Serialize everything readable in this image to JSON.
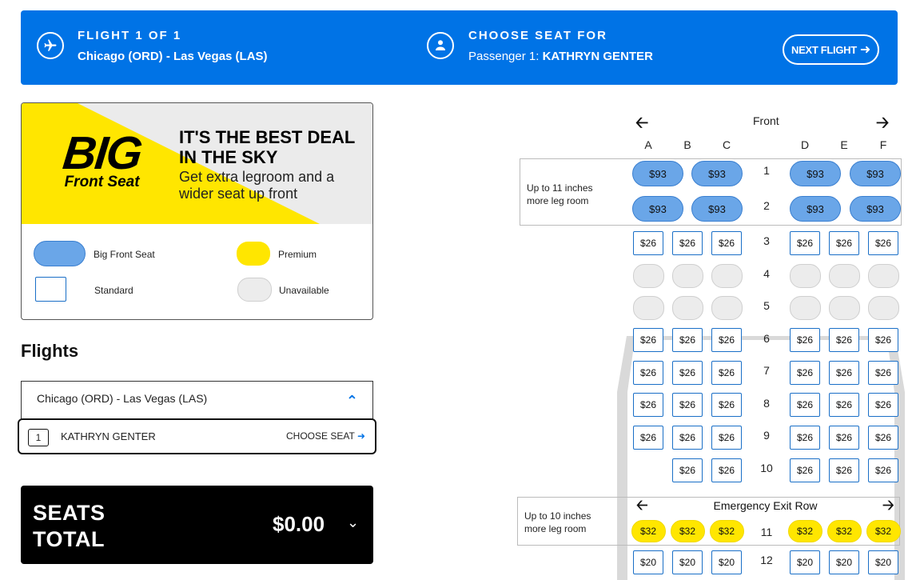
{
  "header": {
    "flight_kicker": "FLIGHT 1 OF 1",
    "flight_route": "Chicago (ORD) - Las Vegas (LAS)",
    "seat_kicker": "CHOOSE SEAT FOR",
    "passenger_prefix": "Passenger 1: ",
    "passenger_name": "KATHRYN GENTER",
    "next_flight_label": "NEXT FLIGHT"
  },
  "promo": {
    "logo_big": "BIG",
    "logo_sub": "Front Seat",
    "headline": "IT'S THE BEST DEAL IN THE SKY",
    "subline": "Get extra legroom and a wider seat up front",
    "legend": {
      "big_front_seat": "Big Front Seat",
      "premium": "Premium",
      "standard": "Standard",
      "unavailable": "Unavailable"
    }
  },
  "flights": {
    "title": "Flights",
    "route": "Chicago (ORD) - Las Vegas (LAS)",
    "passenger_number": "1",
    "passenger_name": "KATHRYN GENTER",
    "choose_seat_label": "CHOOSE SEAT"
  },
  "total": {
    "label_line1": "SEATS",
    "label_line2": "TOTAL",
    "amount": "$0.00"
  },
  "seatmap": {
    "front_label": "Front",
    "columns": [
      "A",
      "B",
      "C",
      "D",
      "E",
      "F"
    ],
    "zone_big_label": "Up to 11 inches more leg room",
    "zone_exit_label": "Up to 10 inches more leg room",
    "exit_row_label": "Emergency Exit Row",
    "rows": [
      {
        "row": "1",
        "type": "big",
        "seats": [
          "$93",
          "$93",
          "$93",
          "$93"
        ]
      },
      {
        "row": "2",
        "type": "big",
        "seats": [
          "$93",
          "$93",
          "$93",
          "$93"
        ]
      },
      {
        "row": "3",
        "type": "std",
        "seats": [
          "$26",
          "$26",
          "$26",
          "$26",
          "$26",
          "$26"
        ]
      },
      {
        "row": "4",
        "type": "una",
        "seats": [
          "",
          "",
          "",
          "",
          "",
          ""
        ]
      },
      {
        "row": "5",
        "type": "una",
        "seats": [
          "",
          "",
          "",
          "",
          "",
          ""
        ]
      },
      {
        "row": "6",
        "type": "std",
        "seats": [
          "$26",
          "$26",
          "$26",
          "$26",
          "$26",
          "$26"
        ]
      },
      {
        "row": "7",
        "type": "std",
        "seats": [
          "$26",
          "$26",
          "$26",
          "$26",
          "$26",
          "$26"
        ]
      },
      {
        "row": "8",
        "type": "std",
        "seats": [
          "$26",
          "$26",
          "$26",
          "$26",
          "$26",
          "$26"
        ]
      },
      {
        "row": "9",
        "type": "std",
        "seats": [
          "$26",
          "$26",
          "$26",
          "$26",
          "$26",
          "$26"
        ]
      },
      {
        "row": "10",
        "type": "std",
        "seats": [
          null,
          "$26",
          "$26",
          "$26",
          "$26",
          "$26"
        ]
      },
      {
        "row": "11",
        "type": "prem",
        "seats": [
          "$32",
          "$32",
          "$32",
          "$32",
          "$32",
          "$32"
        ]
      },
      {
        "row": "12",
        "type": "std",
        "seats": [
          "$20",
          "$20",
          "$20",
          "$20",
          "$20",
          "$20"
        ]
      }
    ]
  },
  "colors": {
    "brand_blue": "#0073e6",
    "big_seat": "#6aa6e8",
    "premium": "#ffe600",
    "unavailable": "#ececec"
  }
}
